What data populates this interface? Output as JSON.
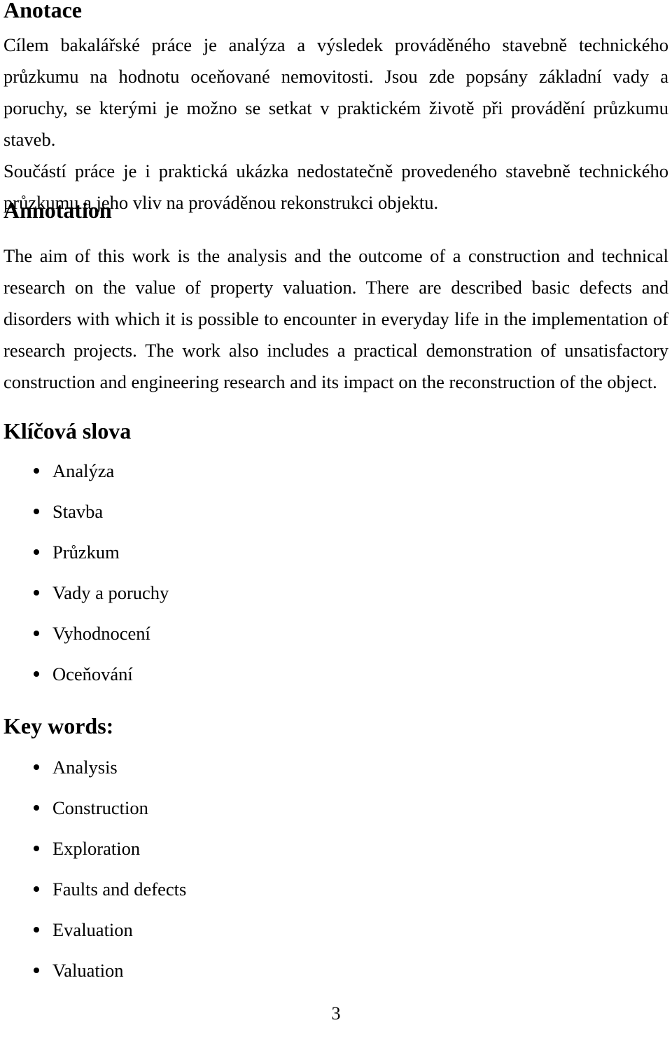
{
  "document": {
    "language_primary": "cs",
    "page_number": "3"
  },
  "sections": {
    "anotace": {
      "heading": "Anotace",
      "paragraphs": [
        "Cílem bakalářské práce je analýza a výsledek prováděného stavebně technického průzkumu na hodnotu oceňované nemovitosti. Jsou zde popsány základní vady a poruchy, se kterými je možno se setkat v praktickém životě při provádění průzkumu staveb.",
        "Součástí práce je i praktická ukázka nedostatečně provedeného stavebně technického průzkumu a jeho vliv na prováděnou rekonstrukci objektu."
      ]
    },
    "annotation": {
      "heading": "Annotation",
      "paragraphs": [
        "The aim of this work is the analysis and the outcome of a construction and technical research on the value of property valuation. There are described basic defects and disorders with which it is possible to encounter in everyday life in the implementation of research projects. The work also includes a practical demonstration of unsatisfactory construction and engineering research and its impact on the reconstruction of the object."
      ]
    },
    "klicova_slova": {
      "heading": "Klíčová slova",
      "items": [
        "Analýza",
        "Stavba",
        "Průzkum",
        "Vady a poruchy",
        "Vyhodnocení",
        "Oceňování"
      ]
    },
    "key_words": {
      "heading": "Key words:",
      "items": [
        "Analysis",
        "Construction",
        "Exploration",
        "Faults and defects",
        "Evaluation",
        "Valuation"
      ]
    }
  },
  "colors": {
    "text": "#000000",
    "background": "#ffffff"
  }
}
